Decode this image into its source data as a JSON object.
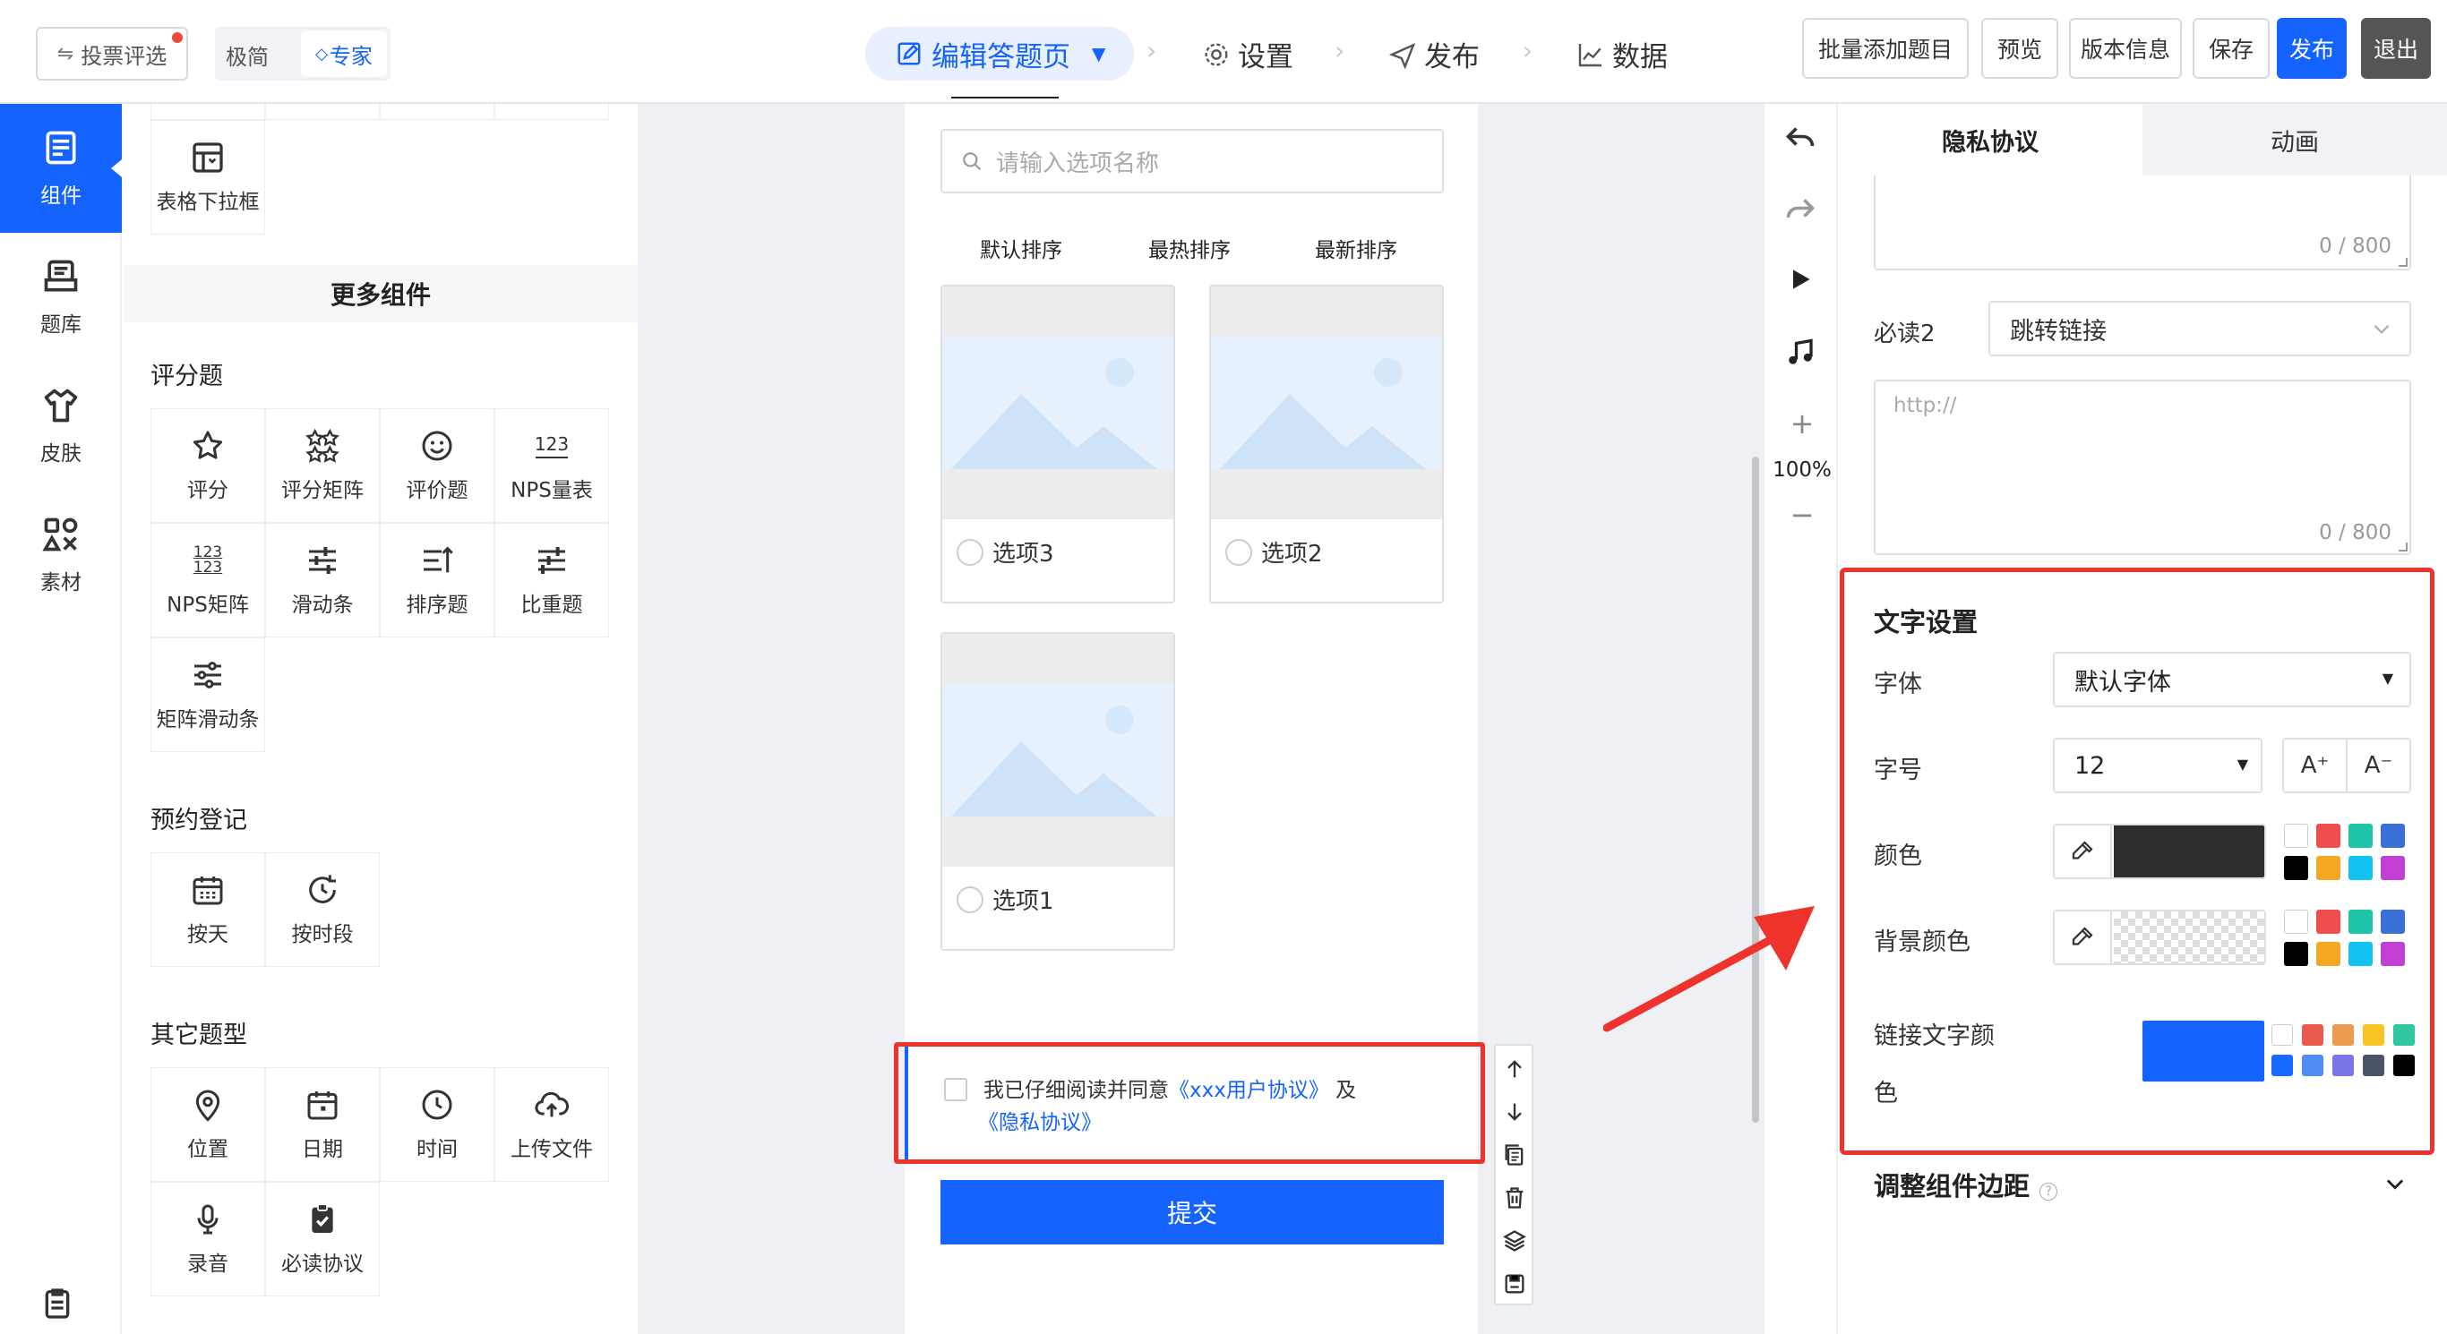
{
  "topbar": {
    "vote_label": "投票评选",
    "mode_simple": "极简",
    "mode_expert": "专家",
    "nav": [
      {
        "label": "编辑答题页"
      },
      {
        "label": "设置"
      },
      {
        "label": "发布"
      },
      {
        "label": "数据"
      }
    ],
    "btn_batch": "批量添加题目",
    "btn_preview": "预览",
    "btn_version": "版本信息",
    "btn_save": "保存",
    "btn_publish": "发布",
    "btn_exit": "退出"
  },
  "leftnav": [
    {
      "label": "组件",
      "icon": "component-icon",
      "active": true
    },
    {
      "label": "题库",
      "icon": "question-bank-icon"
    },
    {
      "label": "皮肤",
      "icon": "skin-icon"
    },
    {
      "label": "素材",
      "icon": "material-icon"
    }
  ],
  "components": {
    "table_dropdown": "表格下拉框",
    "more_title": "更多组件",
    "rating_title": "评分题",
    "rating": [
      "评分",
      "评分矩阵",
      "评价题",
      "NPS量表",
      "NPS矩阵",
      "滑动条",
      "排序题",
      "比重题",
      "矩阵滑动条"
    ],
    "booking_title": "预约登记",
    "booking": [
      "按天",
      "按时段"
    ],
    "other_title": "其它题型",
    "other": [
      "位置",
      "日期",
      "时间",
      "上传文件",
      "录音",
      "必读协议"
    ],
    "nps_icon_text": "123"
  },
  "canvas": {
    "search_placeholder": "请输入选项名称",
    "sort_tabs": [
      "默认排序",
      "最热排序",
      "最新排序"
    ],
    "options": [
      "选项3",
      "选项2",
      "选项1"
    ],
    "agreement_text": "我已仔细阅读并同意",
    "agreement_link1": "《xxx用户协议》",
    "agreement_and": "及",
    "agreement_link2": "《隐私协议》",
    "submit": "提交"
  },
  "righttool": {
    "zoom": "100%"
  },
  "props": {
    "tabs": [
      "隐私协议",
      "动画"
    ],
    "counter1": "0 / 800",
    "must_read2_label": "必读2",
    "must_read2_value": "跳转链接",
    "url_placeholder": "http://",
    "counter2": "0 / 800",
    "text_settings_title": "文字设置",
    "font_label": "字体",
    "font_value": "默认字体",
    "size_label": "字号",
    "size_value": "12",
    "size_up": "A⁺",
    "size_down": "A⁻",
    "color_label": "颜色",
    "bg_color_label": "背景颜色",
    "link_color_label_1": "链接文字颜",
    "link_color_label_2": "色",
    "margin_label": "调整组件边距",
    "text_color": "#2e2e2e",
    "link_color": "#1463ff",
    "palette": [
      "#ffffff",
      "#f04e4e",
      "#1ec4a8",
      "#3a6fd8",
      "#000000",
      "#f5a623",
      "#12c2f0",
      "#c23fd4"
    ],
    "link_palette": [
      "#ffffff",
      "#ea5b4d",
      "#ec9a4f",
      "#f7c325",
      "#2fc7a0",
      "#1769ff",
      "#4f8cf4",
      "#7b74e8",
      "#4a5467",
      "#000000"
    ]
  }
}
